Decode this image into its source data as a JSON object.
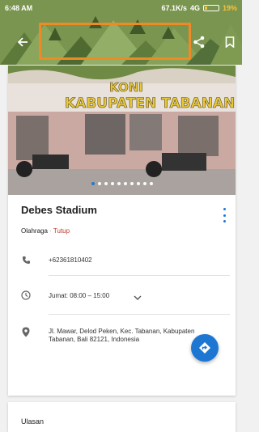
{
  "status_bar": {
    "time": "6:48 AM",
    "network_speed": "67.1K/s",
    "network_type": "4G",
    "battery": "19%"
  },
  "toolbar": {
    "back_icon": "arrow-left-icon",
    "share_icon": "share-icon",
    "bookmark_icon": "bookmark-icon"
  },
  "photo": {
    "sign_line1": "KONI",
    "sign_line2": "KABUPATEN TABANAN",
    "carousel_total": 10,
    "carousel_active": 1
  },
  "place": {
    "name": "Debes Stadium",
    "category": "Olahraga",
    "separator": "·",
    "status": "Tutup",
    "phone": "+62361810402",
    "hours": "Jumat: 08:00 – 15:00",
    "address": "Jl. Mawar, Delod Peken, Kec. Tabanan, Kabupaten Tabanan, Bali 82121, Indonesia"
  },
  "reviews": {
    "title": "Ulasan"
  },
  "colors": {
    "accent": "#1e76d3",
    "closed_status": "#c0392b",
    "highlight_box": "#f08a24"
  }
}
